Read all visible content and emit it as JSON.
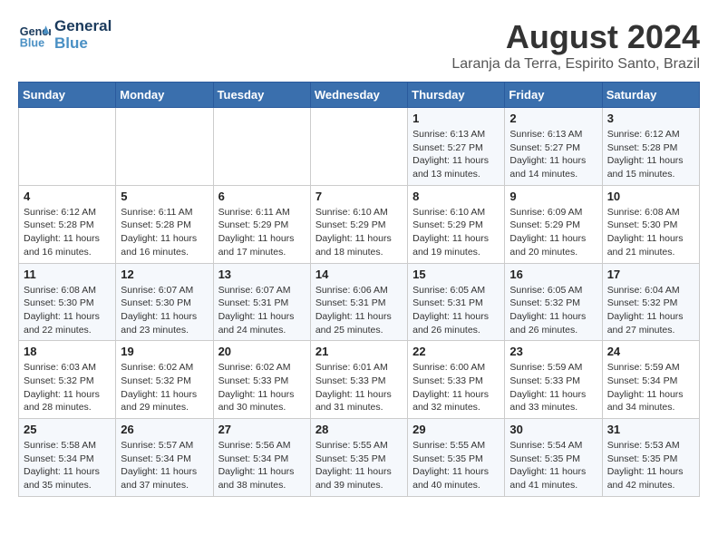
{
  "header": {
    "logo_line1": "General",
    "logo_line2": "Blue",
    "month_year": "August 2024",
    "location": "Laranja da Terra, Espirito Santo, Brazil"
  },
  "weekdays": [
    "Sunday",
    "Monday",
    "Tuesday",
    "Wednesday",
    "Thursday",
    "Friday",
    "Saturday"
  ],
  "weeks": [
    [
      {
        "day": "",
        "info": ""
      },
      {
        "day": "",
        "info": ""
      },
      {
        "day": "",
        "info": ""
      },
      {
        "day": "",
        "info": ""
      },
      {
        "day": "1",
        "info": "Sunrise: 6:13 AM\nSunset: 5:27 PM\nDaylight: 11 hours\nand 13 minutes."
      },
      {
        "day": "2",
        "info": "Sunrise: 6:13 AM\nSunset: 5:27 PM\nDaylight: 11 hours\nand 14 minutes."
      },
      {
        "day": "3",
        "info": "Sunrise: 6:12 AM\nSunset: 5:28 PM\nDaylight: 11 hours\nand 15 minutes."
      }
    ],
    [
      {
        "day": "4",
        "info": "Sunrise: 6:12 AM\nSunset: 5:28 PM\nDaylight: 11 hours\nand 16 minutes."
      },
      {
        "day": "5",
        "info": "Sunrise: 6:11 AM\nSunset: 5:28 PM\nDaylight: 11 hours\nand 16 minutes."
      },
      {
        "day": "6",
        "info": "Sunrise: 6:11 AM\nSunset: 5:29 PM\nDaylight: 11 hours\nand 17 minutes."
      },
      {
        "day": "7",
        "info": "Sunrise: 6:10 AM\nSunset: 5:29 PM\nDaylight: 11 hours\nand 18 minutes."
      },
      {
        "day": "8",
        "info": "Sunrise: 6:10 AM\nSunset: 5:29 PM\nDaylight: 11 hours\nand 19 minutes."
      },
      {
        "day": "9",
        "info": "Sunrise: 6:09 AM\nSunset: 5:29 PM\nDaylight: 11 hours\nand 20 minutes."
      },
      {
        "day": "10",
        "info": "Sunrise: 6:08 AM\nSunset: 5:30 PM\nDaylight: 11 hours\nand 21 minutes."
      }
    ],
    [
      {
        "day": "11",
        "info": "Sunrise: 6:08 AM\nSunset: 5:30 PM\nDaylight: 11 hours\nand 22 minutes."
      },
      {
        "day": "12",
        "info": "Sunrise: 6:07 AM\nSunset: 5:30 PM\nDaylight: 11 hours\nand 23 minutes."
      },
      {
        "day": "13",
        "info": "Sunrise: 6:07 AM\nSunset: 5:31 PM\nDaylight: 11 hours\nand 24 minutes."
      },
      {
        "day": "14",
        "info": "Sunrise: 6:06 AM\nSunset: 5:31 PM\nDaylight: 11 hours\nand 25 minutes."
      },
      {
        "day": "15",
        "info": "Sunrise: 6:05 AM\nSunset: 5:31 PM\nDaylight: 11 hours\nand 26 minutes."
      },
      {
        "day": "16",
        "info": "Sunrise: 6:05 AM\nSunset: 5:32 PM\nDaylight: 11 hours\nand 26 minutes."
      },
      {
        "day": "17",
        "info": "Sunrise: 6:04 AM\nSunset: 5:32 PM\nDaylight: 11 hours\nand 27 minutes."
      }
    ],
    [
      {
        "day": "18",
        "info": "Sunrise: 6:03 AM\nSunset: 5:32 PM\nDaylight: 11 hours\nand 28 minutes."
      },
      {
        "day": "19",
        "info": "Sunrise: 6:02 AM\nSunset: 5:32 PM\nDaylight: 11 hours\nand 29 minutes."
      },
      {
        "day": "20",
        "info": "Sunrise: 6:02 AM\nSunset: 5:33 PM\nDaylight: 11 hours\nand 30 minutes."
      },
      {
        "day": "21",
        "info": "Sunrise: 6:01 AM\nSunset: 5:33 PM\nDaylight: 11 hours\nand 31 minutes."
      },
      {
        "day": "22",
        "info": "Sunrise: 6:00 AM\nSunset: 5:33 PM\nDaylight: 11 hours\nand 32 minutes."
      },
      {
        "day": "23",
        "info": "Sunrise: 5:59 AM\nSunset: 5:33 PM\nDaylight: 11 hours\nand 33 minutes."
      },
      {
        "day": "24",
        "info": "Sunrise: 5:59 AM\nSunset: 5:34 PM\nDaylight: 11 hours\nand 34 minutes."
      }
    ],
    [
      {
        "day": "25",
        "info": "Sunrise: 5:58 AM\nSunset: 5:34 PM\nDaylight: 11 hours\nand 35 minutes."
      },
      {
        "day": "26",
        "info": "Sunrise: 5:57 AM\nSunset: 5:34 PM\nDaylight: 11 hours\nand 37 minutes."
      },
      {
        "day": "27",
        "info": "Sunrise: 5:56 AM\nSunset: 5:34 PM\nDaylight: 11 hours\nand 38 minutes."
      },
      {
        "day": "28",
        "info": "Sunrise: 5:55 AM\nSunset: 5:35 PM\nDaylight: 11 hours\nand 39 minutes."
      },
      {
        "day": "29",
        "info": "Sunrise: 5:55 AM\nSunset: 5:35 PM\nDaylight: 11 hours\nand 40 minutes."
      },
      {
        "day": "30",
        "info": "Sunrise: 5:54 AM\nSunset: 5:35 PM\nDaylight: 11 hours\nand 41 minutes."
      },
      {
        "day": "31",
        "info": "Sunrise: 5:53 AM\nSunset: 5:35 PM\nDaylight: 11 hours\nand 42 minutes."
      }
    ]
  ]
}
